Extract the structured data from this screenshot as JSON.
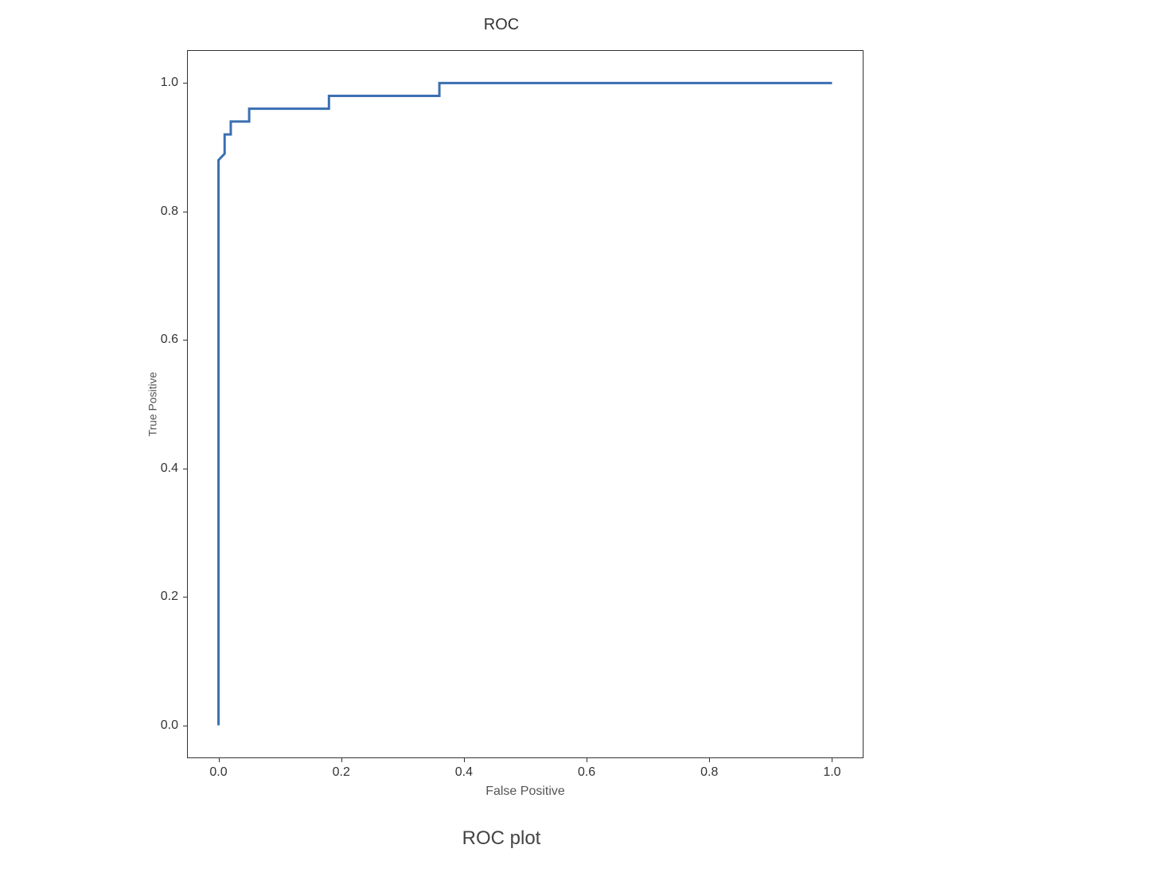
{
  "chart_data": {
    "type": "line",
    "title": "ROC",
    "xlabel": "False Positive",
    "ylabel": "True Positive",
    "xlim": [
      -0.05,
      1.05
    ],
    "ylim": [
      -0.05,
      1.05
    ],
    "x_ticks": [
      0.0,
      0.2,
      0.4,
      0.6,
      0.8,
      1.0
    ],
    "x_tick_labels": [
      "0.0",
      "0.2",
      "0.4",
      "0.6",
      "0.8",
      "1.0"
    ],
    "y_ticks": [
      0.0,
      0.2,
      0.4,
      0.6,
      0.8,
      1.0
    ],
    "y_tick_labels": [
      "0.0",
      "0.2",
      "0.4",
      "0.6",
      "0.8",
      "1.0"
    ],
    "grid": false,
    "legend": false,
    "series": [
      {
        "name": "ROC curve",
        "color": "#3b6fb2",
        "x": [
          0.0,
          0.0,
          0.01,
          0.01,
          0.02,
          0.02,
          0.05,
          0.05,
          0.18,
          0.18,
          0.36,
          0.36,
          1.0
        ],
        "y": [
          0.0,
          0.88,
          0.89,
          0.92,
          0.92,
          0.94,
          0.94,
          0.96,
          0.96,
          0.98,
          0.98,
          1.0,
          1.0
        ]
      }
    ]
  },
  "caption": "ROC plot"
}
